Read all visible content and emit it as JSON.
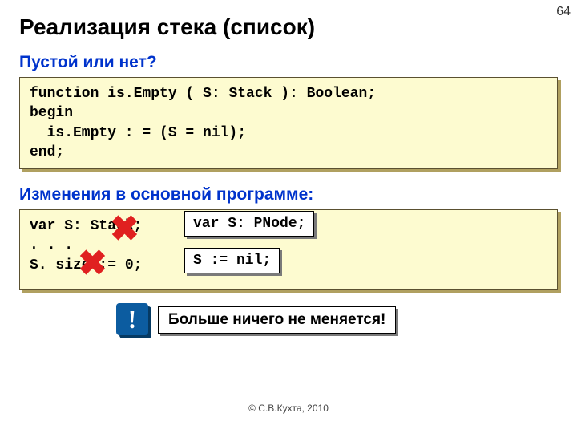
{
  "page_number": "64",
  "title": "Реализация стека (список)",
  "section1": {
    "heading": "Пустой или нет?",
    "code": {
      "l1": "function is.Empty ( S: Stack ): Boolean;",
      "l2": "begin",
      "l3": "is.Empty : = (S = nil);",
      "l4": "end;"
    }
  },
  "section2": {
    "heading": "Изменения в основной программе:",
    "code": {
      "l1": "var S: Stack;",
      "l2": ". . .",
      "l3": "S. size := 0;"
    },
    "snippet1": "var S: PNode;",
    "snippet2": "S := nil;"
  },
  "callout": {
    "bang": "!",
    "text": "Больше ничего не меняется!"
  },
  "copyright": "© С.В.Кухта, 2010",
  "cross_glyph": "✖"
}
